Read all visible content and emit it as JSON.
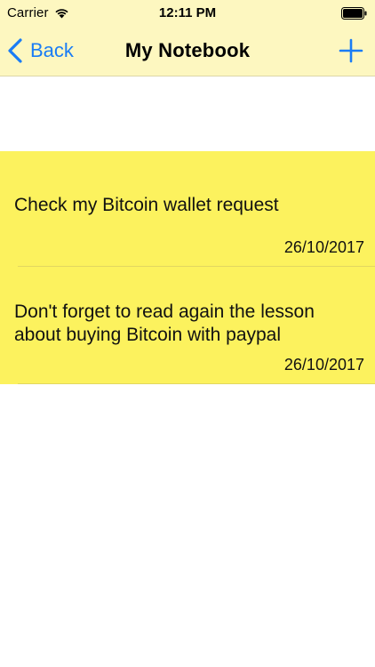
{
  "status_bar": {
    "carrier": "Carrier",
    "time": "12:11 PM",
    "wifi_icon": "wifi-icon",
    "battery_icon": "battery-icon"
  },
  "nav_bar": {
    "back_label": "Back",
    "title": "My Notebook",
    "add_icon": "plus-icon"
  },
  "notes": [
    {
      "text": "Check my Bitcoin wallet request",
      "date": "26/10/2017"
    },
    {
      "text": "Don't forget to read again the lesson about buying Bitcoin with paypal",
      "date": "26/10/2017"
    }
  ],
  "colors": {
    "nav_background": "#fdf7c0",
    "note_background": "#fcf25e",
    "accent": "#1a7cf5"
  }
}
